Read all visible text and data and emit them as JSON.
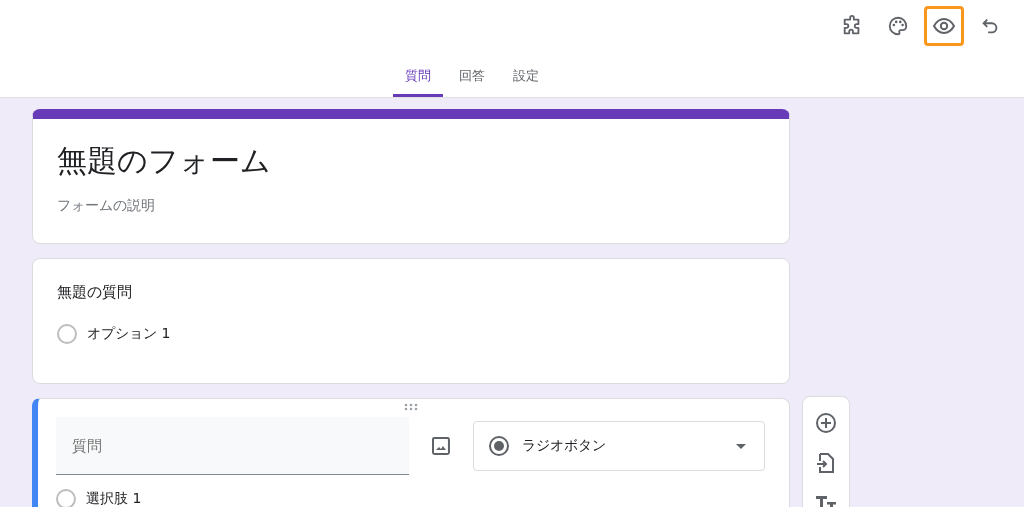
{
  "toolbar": [
    {
      "kind": "addon",
      "highlighted": false
    },
    {
      "kind": "palette",
      "highlighted": false
    },
    {
      "kind": "preview",
      "highlighted": true
    },
    {
      "kind": "undo",
      "highlighted": false
    }
  ],
  "tabs": [
    {
      "label": "質問",
      "selected": true
    },
    {
      "label": "回答",
      "selected": false
    },
    {
      "label": "設定",
      "selected": false
    }
  ],
  "form": {
    "title": "無題のフォーム",
    "description": "フォームの説明"
  },
  "question": {
    "title": "無題の質問",
    "options": [
      {
        "label": "オプション 1",
        "selected": false
      }
    ]
  },
  "editor": {
    "placeholder": "質問",
    "type": "ラジオボタン",
    "options": [
      {
        "label": "選択肢 1",
        "selected": false
      }
    ]
  },
  "side_tools": [
    {
      "kind": "add"
    },
    {
      "kind": "import"
    },
    {
      "kind": "text"
    }
  ]
}
